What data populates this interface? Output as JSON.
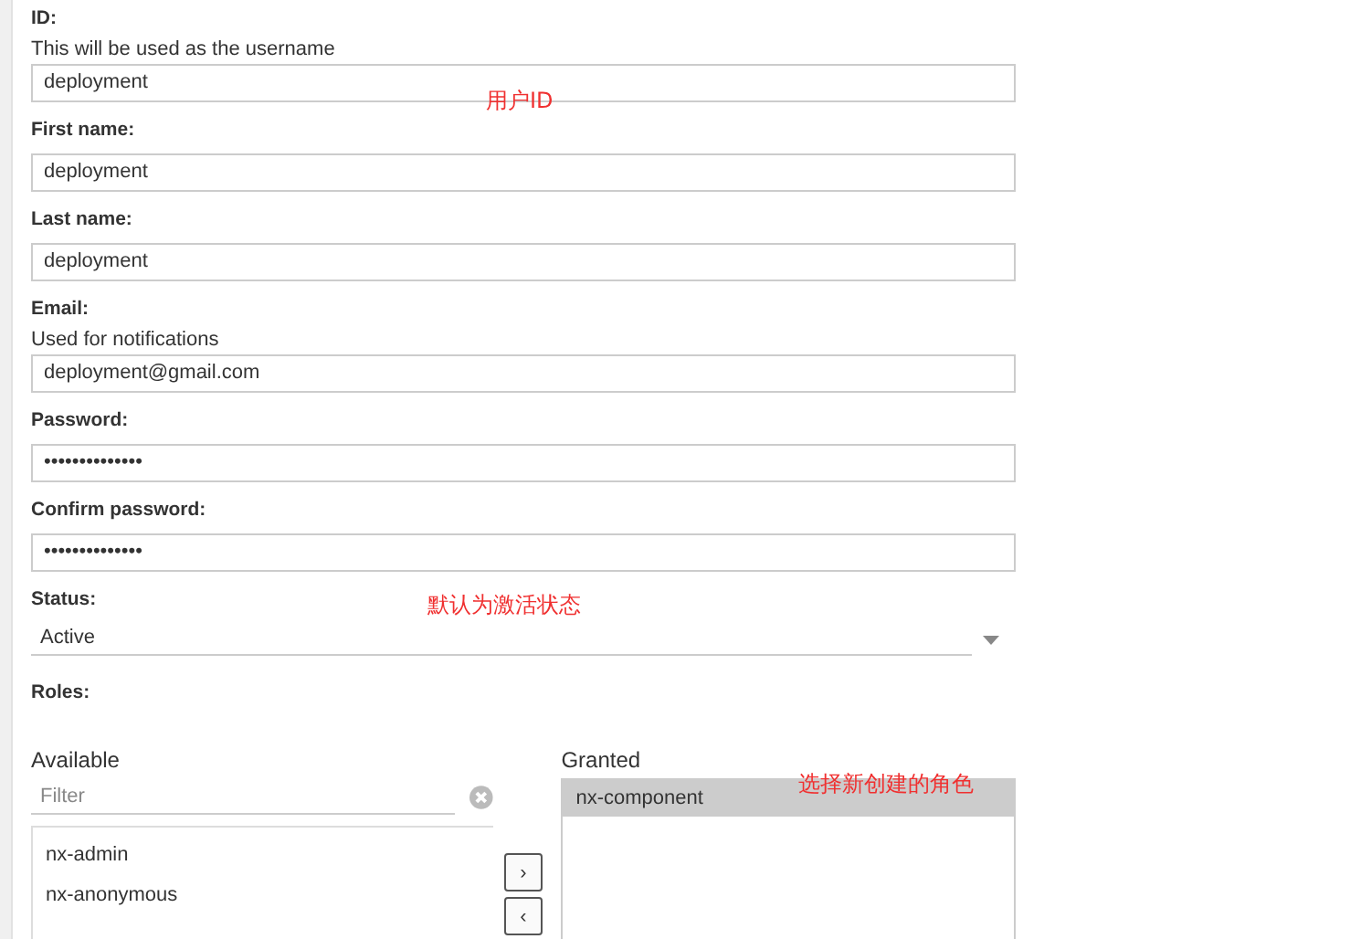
{
  "fields": [
    {
      "label": "ID:",
      "hint": "This will be used as the username",
      "value": "deployment"
    },
    {
      "label": "First name:",
      "value": "deployment"
    },
    {
      "label": "Last name:",
      "value": "deployment"
    },
    {
      "label": "Email:",
      "hint": "Used for notifications",
      "value": "deployment@gmail.com"
    },
    {
      "label": "Password:",
      "value": "••••••••••••••"
    },
    {
      "label": "Confirm password:",
      "value": "••••••••••••••"
    }
  ],
  "status": {
    "label": "Status:",
    "value": "Active"
  },
  "roles": {
    "label": "Roles:",
    "available": {
      "title": "Available",
      "filter_placeholder": "Filter",
      "items": [
        {
          "label": "nx-admin",
          "selected": false
        },
        {
          "label": "nx-anonymous",
          "selected": false
        }
      ]
    },
    "move_buttons": [
      "›",
      "‹"
    ],
    "granted": {
      "title": "Granted",
      "items": [
        {
          "label": "nx-component",
          "selected": true
        }
      ]
    }
  },
  "annotations": [
    "用户ID",
    "默认为激活状态",
    "选择新创建的角色"
  ]
}
